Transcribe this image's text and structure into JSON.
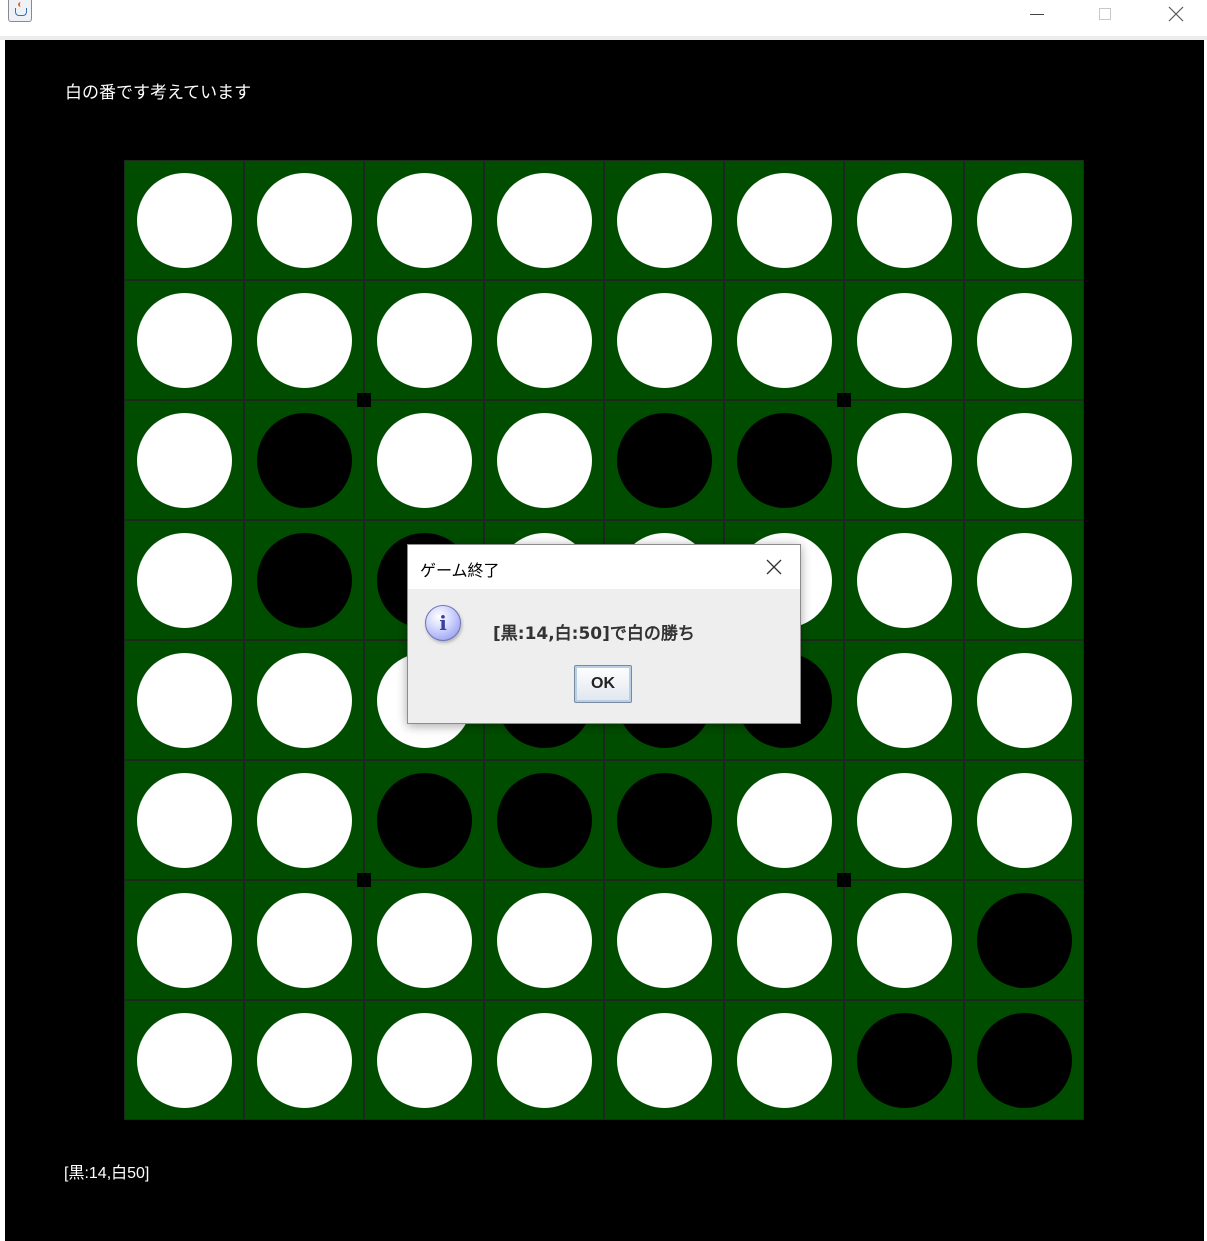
{
  "window": {
    "title_icon": "java-cup-icon"
  },
  "game": {
    "status": "白の番です考えています",
    "score": "[黒:14,白50]",
    "board": [
      [
        "W",
        "W",
        "W",
        "W",
        "W",
        "W",
        "W",
        "W"
      ],
      [
        "W",
        "W",
        "W",
        "W",
        "W",
        "W",
        "W",
        "W"
      ],
      [
        "W",
        "B",
        "W",
        "W",
        "B",
        "B",
        "W",
        "W"
      ],
      [
        "W",
        "B",
        "B",
        "W",
        "W",
        "W",
        "W",
        "W"
      ],
      [
        "W",
        "W",
        "W",
        "B",
        "B",
        "B",
        "W",
        "W"
      ],
      [
        "W",
        "W",
        "B",
        "B",
        "B",
        "W",
        "W",
        "W"
      ],
      [
        "W",
        "W",
        "W",
        "W",
        "W",
        "W",
        "W",
        "B"
      ],
      [
        "W",
        "W",
        "W",
        "W",
        "W",
        "W",
        "B",
        "B"
      ]
    ],
    "colors": {
      "board_green": "#004d00",
      "background": "#000000",
      "white_disc": "#ffffff",
      "black_disc": "#000000"
    }
  },
  "dialog": {
    "title": "ゲーム終了",
    "message": "[黒:14,白:50]で白の勝ち",
    "ok_label": "OK",
    "icon": "info-icon"
  }
}
